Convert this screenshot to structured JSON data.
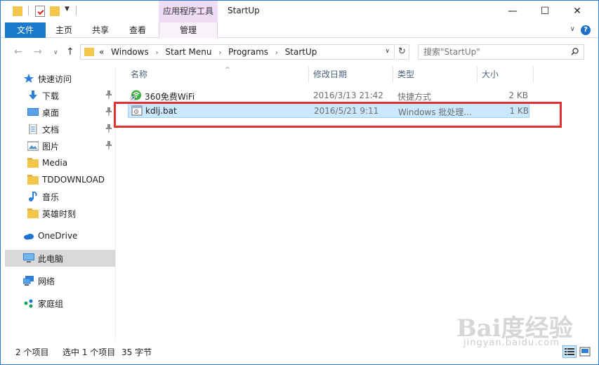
{
  "window": {
    "title": "StartUp",
    "context_tab_group": "应用程序工具",
    "min_glyph": "—",
    "max_glyph": "☐",
    "close_glyph": "✕"
  },
  "ribbon": {
    "tabs": [
      "文件",
      "主页",
      "共享",
      "查看",
      "管理"
    ],
    "chevron": "∨",
    "help": "?"
  },
  "address": {
    "back_glyph": "←",
    "forward_glyph": "→",
    "history_glyph": "∨",
    "up_glyph": "↑",
    "overflow": "«",
    "crumbs": [
      "Windows",
      "Start Menu",
      "Programs",
      "StartUp"
    ],
    "separator": "›",
    "dropdown_glyph": "∨",
    "refresh_glyph": "↻"
  },
  "search": {
    "placeholder": "搜索\"StartUp\""
  },
  "nav": {
    "items": [
      {
        "label": "快速访问",
        "icon": "star-icon"
      },
      {
        "label": "下载",
        "icon": "download-icon",
        "pinned": true
      },
      {
        "label": "桌面",
        "icon": "desktop-icon",
        "pinned": true
      },
      {
        "label": "文档",
        "icon": "documents-icon",
        "pinned": true
      },
      {
        "label": "图片",
        "icon": "pictures-icon",
        "pinned": true
      },
      {
        "label": "Media",
        "icon": "folder-icon"
      },
      {
        "label": "TDDOWNLOAD",
        "icon": "folder-icon"
      },
      {
        "label": "音乐",
        "icon": "music-icon"
      },
      {
        "label": "英雄时刻",
        "icon": "folder-icon"
      },
      {
        "label": "OneDrive",
        "icon": "onedrive-icon"
      },
      {
        "label": "此电脑",
        "icon": "computer-icon",
        "selected": true
      },
      {
        "label": "网络",
        "icon": "network-icon"
      },
      {
        "label": "家庭组",
        "icon": "homegroup-icon"
      }
    ]
  },
  "columns": {
    "name": "名称",
    "modified": "修改日期",
    "type": "类型",
    "size": "大小",
    "sort_glyph": "^"
  },
  "files": [
    {
      "name": "360免费WiFi",
      "modified": "2016/3/13 21:42",
      "type": "快捷方式",
      "size": "2 KB",
      "icon": "wifi-shortcut-icon",
      "selected": false
    },
    {
      "name": "kdlj.bat",
      "modified": "2016/5/21 9:11",
      "type": "Windows 批处理...",
      "size": "1 KB",
      "icon": "batch-file-icon",
      "selected": true
    }
  ],
  "status": {
    "item_count": "2 个项目",
    "selection": "选中 1 个项目",
    "selection_size": "35 字节"
  },
  "watermark": {
    "brand": "Bai度经验",
    "url": "jingyan.baidu.com"
  },
  "colors": {
    "accent": "#1979ca",
    "context_tab": "#f1dcf5",
    "selection": "#cce8ff",
    "highlight": "#e03232",
    "folder": "#f3c64c"
  }
}
